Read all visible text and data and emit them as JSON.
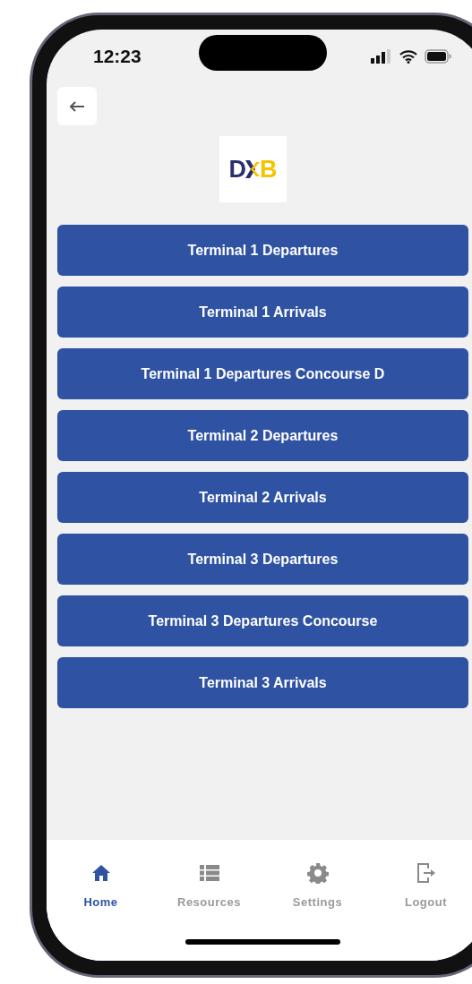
{
  "status_bar": {
    "time": "12:23"
  },
  "header": {
    "logo": {
      "left": "D",
      "right": "B"
    }
  },
  "buttons": [
    {
      "label": "Terminal 1 Departures"
    },
    {
      "label": "Terminal 1 Arrivals"
    },
    {
      "label": "Terminal 1 Departures Concourse D"
    },
    {
      "label": "Terminal 2 Departures"
    },
    {
      "label": "Terminal 2 Arrivals"
    },
    {
      "label": "Terminal 3 Departures"
    },
    {
      "label": "Terminal 3 Departures Concourse"
    },
    {
      "label": "Terminal 3 Arrivals"
    }
  ],
  "tab_bar": [
    {
      "kind": "home",
      "label": "Home",
      "selected": true
    },
    {
      "kind": "resources",
      "label": "Resources",
      "selected": false
    },
    {
      "kind": "settings",
      "label": "Settings",
      "selected": false
    },
    {
      "kind": "logout",
      "label": "Logout",
      "selected": false
    }
  ]
}
